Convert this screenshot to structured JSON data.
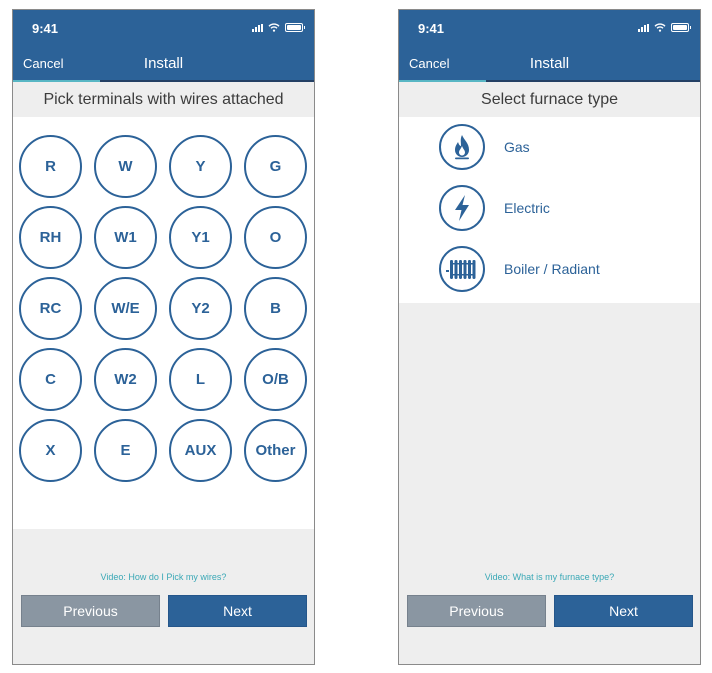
{
  "status_bar": {
    "time": "9:41"
  },
  "colors": {
    "brand": "#2c6298",
    "accent": "#58b6c4",
    "link": "#3aa8b6",
    "secondary_button": "#8a96a2"
  },
  "screen_terminals": {
    "cancel_label": "Cancel",
    "nav_title": "Install",
    "progress": 0.29,
    "heading": "Pick terminals with wires attached",
    "terminals": [
      "R",
      "W",
      "Y",
      "G",
      "RH",
      "W1",
      "Y1",
      "O",
      "RC",
      "W/E",
      "Y2",
      "B",
      "C",
      "W2",
      "L",
      "O/B",
      "X",
      "E",
      "AUX",
      "Other"
    ],
    "video_link": "Video: How do I Pick my wires?",
    "previous_label": "Previous",
    "next_label": "Next"
  },
  "screen_furnace": {
    "cancel_label": "Cancel",
    "nav_title": "Install",
    "progress": 0.29,
    "heading": "Select furnace type",
    "options": [
      {
        "label": "Gas",
        "icon": "flame-icon"
      },
      {
        "label": "Electric",
        "icon": "lightning-bolt-icon"
      },
      {
        "label": "Boiler / Radiant",
        "icon": "radiator-icon"
      }
    ],
    "video_link": "Video: What is my furnace type?",
    "previous_label": "Previous",
    "next_label": "Next"
  }
}
